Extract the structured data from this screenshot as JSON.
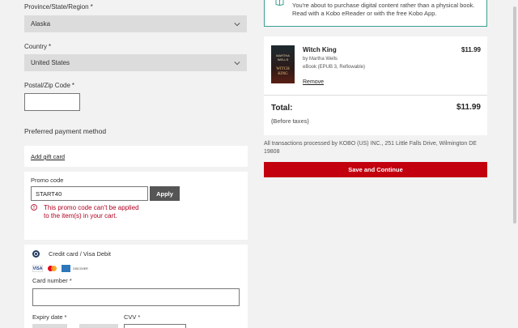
{
  "address": {
    "province_label": "Province/State/Region",
    "province_value": "Alaska",
    "country_label": "Country",
    "country_value": "United States",
    "postal_label": "Postal/Zip Code",
    "postal_value": "",
    "required_mark": "*"
  },
  "payment": {
    "heading": "Preferred payment method",
    "add_gift_card": "Add gift card",
    "promo_label": "Promo code",
    "promo_value": "START40",
    "apply_label": "Apply",
    "promo_error": "This promo code can't be applied to the item(s) in your cart.",
    "credit_label": "Credit card / Visa Debit",
    "card_brands": [
      "visa",
      "mastercard",
      "amex",
      "discover"
    ],
    "card_number_label": "Card number",
    "expiry_label": "Expiry date",
    "cvv_label": "CVV"
  },
  "notice": {
    "text": "You're about to purchase digital content rather than a physical book. Read with a Kobo eReader or with the free Kobo App."
  },
  "summary": {
    "item_title": "Witch King",
    "item_author": "by Martha Wells",
    "item_format": "eBook (EPUB 3, Reflowable)",
    "item_price": "$11.99",
    "remove_label": "Remove",
    "cover_author": "MARTHA WELLS",
    "cover_title": "WITCH KING",
    "total_label": "Total:",
    "total_value": "$11.99",
    "before_taxes": "(Before taxes)",
    "processor_note": "All transactions processed by KOBO (US) INC., 251 Little Falls Drive, Wilmington DE 19808",
    "save_button": "Save and Continue"
  },
  "colors": {
    "accent_red": "#c2000e",
    "error_red": "#b00020",
    "notice_teal": "#3a9e92"
  }
}
